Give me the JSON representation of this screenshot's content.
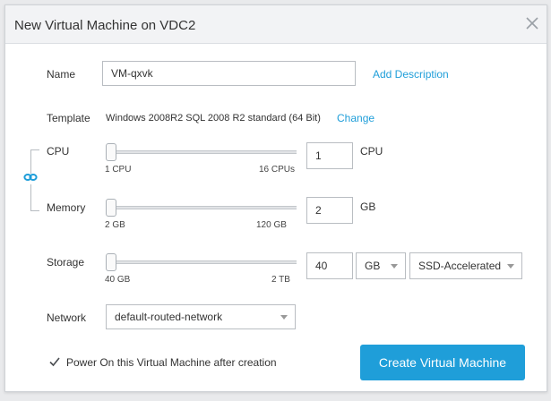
{
  "dialog": {
    "title": "New Virtual Machine on VDC2"
  },
  "name": {
    "label": "Name",
    "value": "VM-qxvk",
    "add_description_label": "Add Description"
  },
  "template": {
    "label": "Template",
    "value": "Windows 2008R2 SQL 2008 R2 standard (64 Bit)",
    "change_label": "Change"
  },
  "cpu": {
    "label": "CPU",
    "min_label": "1 CPU",
    "max_label": "16 CPUs",
    "value": "1",
    "unit": "CPU",
    "fraction": 0.0
  },
  "memory": {
    "label": "Memory",
    "min_label": "2 GB",
    "max_label": "120 GB",
    "value": "2",
    "unit": "GB",
    "fraction": 0.0
  },
  "storage": {
    "label": "Storage",
    "min_label": "40 GB",
    "max_label": "2 TB",
    "value": "40",
    "unit_selected": "GB",
    "tier_selected": "SSD-Accelerated",
    "fraction": 0.0
  },
  "network": {
    "label": "Network",
    "selected": "default-routed-network"
  },
  "power_on": {
    "checked": true,
    "label": "Power On this Virtual Machine after creation"
  },
  "create_button": {
    "label": "Create Virtual Machine"
  },
  "colors": {
    "accent": "#1f9ed9",
    "slider_fill": "#5b5e62"
  },
  "icons": {
    "close": "close-icon",
    "link": "link-chain-icon",
    "check": "checkbox-check-icon"
  }
}
